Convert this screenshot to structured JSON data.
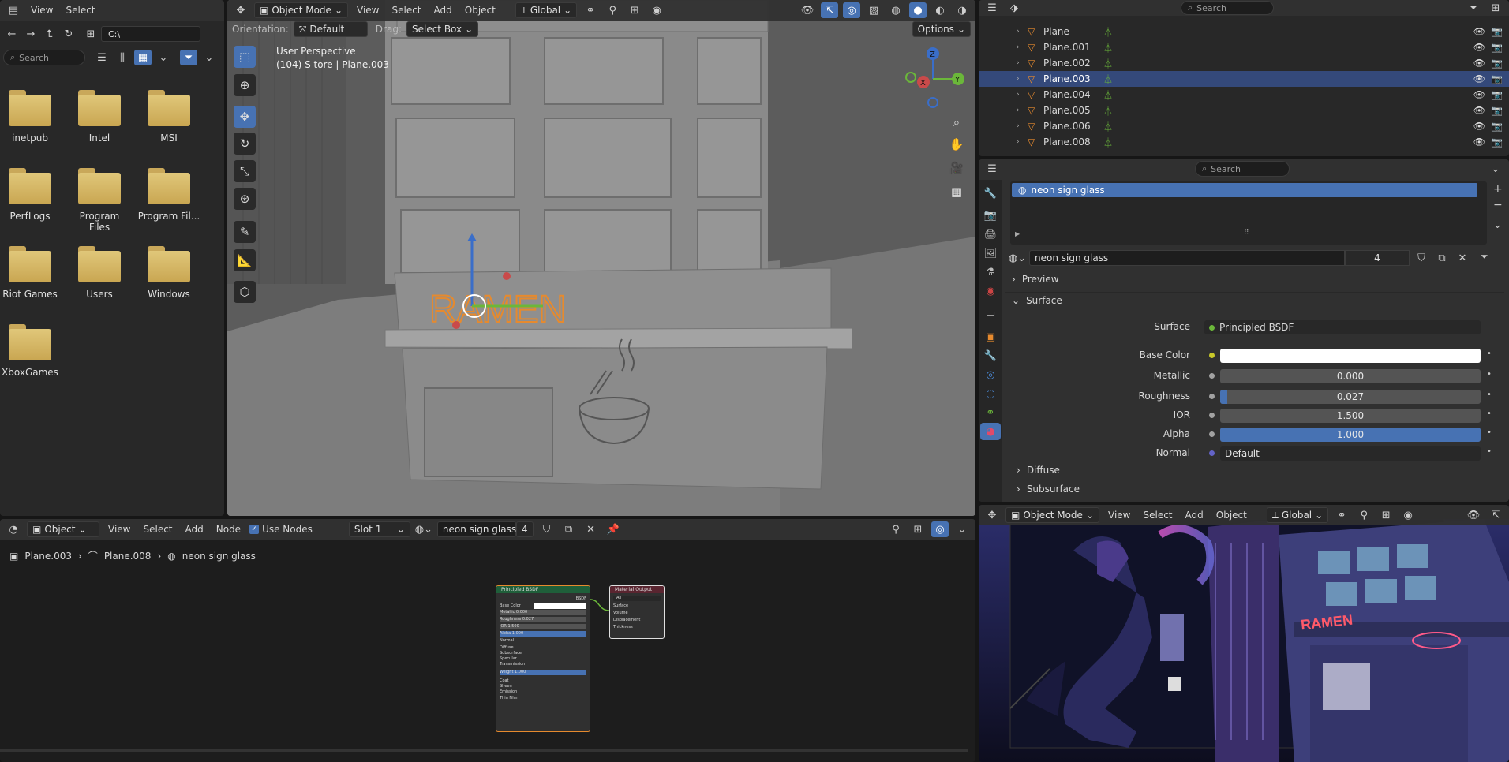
{
  "filebrowser": {
    "menu": [
      "View",
      "Select"
    ],
    "path": "C:\\",
    "search_placeholder": "Search",
    "folders": [
      "inetpub",
      "Intel",
      "MSI",
      "PerfLogs",
      "Program Files",
      "Program Fil...",
      "Riot Games",
      "Users",
      "Windows",
      "XboxGames"
    ]
  },
  "viewport": {
    "mode": "Object Mode",
    "menus": [
      "View",
      "Select",
      "Add",
      "Object"
    ],
    "transform": "Global",
    "orientation_label": "Orientation:",
    "orientation": "Default",
    "drag_label": "Drag:",
    "drag": "Select Box",
    "options": "Options",
    "view_name": "User Perspective",
    "view_info": "(104) S tore | Plane.003",
    "sign_text": "RAMEN"
  },
  "outliner": {
    "search_placeholder": "Search",
    "rows": [
      "Plane",
      "Plane.001",
      "Plane.002",
      "Plane.003",
      "Plane.004",
      "Plane.005",
      "Plane.006",
      "Plane.008"
    ],
    "selected": "Plane.003"
  },
  "properties": {
    "search_placeholder": "Search",
    "slot_name": "neon sign glass",
    "material_name": "neon sign glass",
    "users": "4",
    "panels": {
      "preview": "Preview",
      "surface": "Surface",
      "diffuse": "Diffuse",
      "subsurface": "Subsurface"
    },
    "surface_label": "Surface",
    "surface_value": "Principled BSDF",
    "fields": [
      {
        "label": "Base Color",
        "value": "",
        "kind": "color",
        "dot": "#c8c829"
      },
      {
        "label": "Metallic",
        "value": "0.000",
        "fill": 0.0,
        "dot": "#a1a1a1"
      },
      {
        "label": "Roughness",
        "value": "0.027",
        "fill": 0.027,
        "dot": "#a1a1a1"
      },
      {
        "label": "IOR",
        "value": "1.500",
        "fill": 0.0,
        "dot": "#a1a1a1"
      },
      {
        "label": "Alpha",
        "value": "1.000",
        "fill": 1.0,
        "dot": "#a1a1a1"
      },
      {
        "label": "Normal",
        "value": "Default",
        "kind": "enum",
        "dot": "#6363c7"
      }
    ]
  },
  "nodeeditor": {
    "type": "Object",
    "menus": [
      "View",
      "Select",
      "Add",
      "Node"
    ],
    "use_nodes": "Use Nodes",
    "slot": "Slot 1",
    "material": "neon sign glass",
    "users": "4",
    "breadcrumb": [
      "Plane.003",
      "Plane.008",
      "neon sign glass"
    ],
    "bsdf": {
      "title": "Principled BSDF",
      "out": "BSDF",
      "rows": [
        "Base Color",
        "Metallic 0.000",
        "Roughness 0.027",
        "IOR 1.500",
        "Alpha 1.000",
        "Normal",
        "Diffuse",
        "Subsurface",
        "Specular",
        "Transmission",
        "Weight 1.000",
        "Coat",
        "Sheen",
        "Emission",
        "Thin Film"
      ]
    },
    "output": {
      "title": "Material Output",
      "target": "All",
      "rows": [
        "Surface",
        "Volume",
        "Displacement",
        "Thickness"
      ]
    }
  },
  "render": {
    "mode": "Object Mode",
    "menus": [
      "View",
      "Select",
      "Add",
      "Object"
    ],
    "transform": "Global",
    "sign_text": "RAMEN"
  },
  "colors": {
    "accent": "#4772b3",
    "selection": "#34497a",
    "panel": "#303030",
    "orange": "#e68a2e"
  }
}
